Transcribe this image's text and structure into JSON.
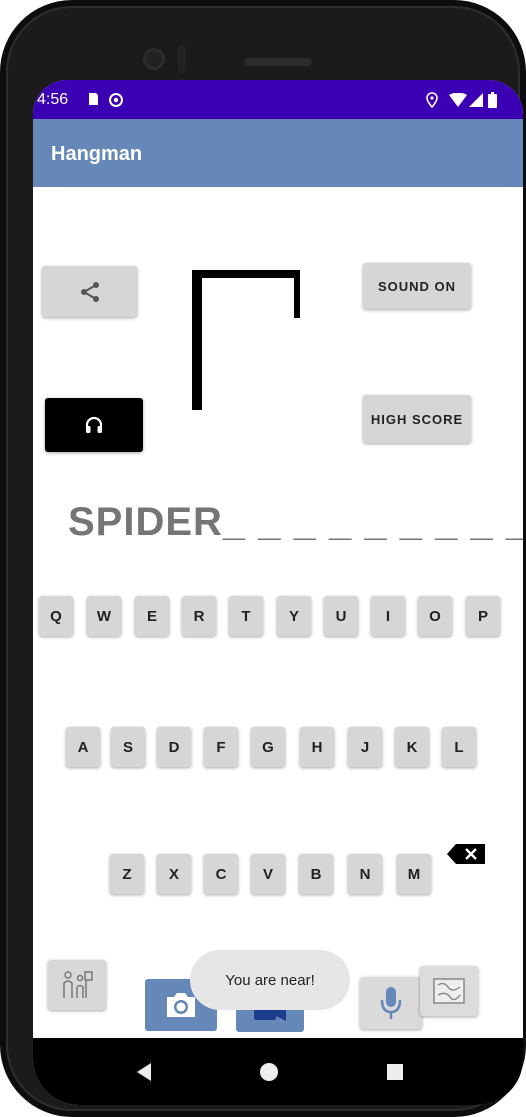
{
  "status_bar": {
    "time": "4:56"
  },
  "app_bar": {
    "title": "Hangman"
  },
  "buttons": {
    "share_icon": "share-icon",
    "sound": "SOUND ON",
    "headphones_icon": "headphones-icon",
    "high_score": "HIGH SCORE"
  },
  "word_display": "SPIDER_ _ _ _ _ _ _ _ _",
  "keyboard": {
    "row1": [
      "Q",
      "W",
      "E",
      "R",
      "T",
      "Y",
      "U",
      "I",
      "O",
      "P"
    ],
    "row2": [
      "A",
      "S",
      "D",
      "F",
      "G",
      "H",
      "J",
      "K",
      "L"
    ],
    "row3": [
      "Z",
      "X",
      "C",
      "V",
      "B",
      "N",
      "M"
    ],
    "backspace_icon": "backspace-icon"
  },
  "bottom_bar": {
    "hint_icon": "family-icon",
    "camera_icon": "camera-icon",
    "video_icon": "video-icon",
    "mic_icon": "microphone-icon",
    "map_icon": "map-icon"
  },
  "toast": "You are near!",
  "colors": {
    "status_bar": "#3b00b3",
    "app_bar": "#6688b8",
    "button_bg": "#d6d6d6",
    "word": "#757575",
    "bottom_icons": "#6688b8"
  }
}
